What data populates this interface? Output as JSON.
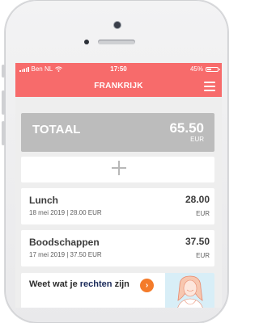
{
  "status": {
    "carrier": "Ben NL",
    "time": "17:50",
    "battery": "45%",
    "battery_level": 0.45
  },
  "header": {
    "title": "FRANKRIJK"
  },
  "total": {
    "label": "TOTAAL",
    "amount": "65.50",
    "currency": "EUR"
  },
  "expenses": [
    {
      "name": "Lunch",
      "subtitle": "18 mei 2019 | 28.00 EUR",
      "amount": "28.00",
      "currency": "EUR"
    },
    {
      "name": "Boodschappen",
      "subtitle": "17 mei 2019 | 37.50 EUR",
      "amount": "37.50",
      "currency": "EUR"
    }
  ],
  "promo": {
    "text_before": "Weet wat je ",
    "text_bold": "rechten",
    "text_after": " zijn"
  },
  "colors": {
    "accent": "#f76b6b",
    "total_bg": "#bcbcbc",
    "promo_button": "#f47b2a"
  }
}
